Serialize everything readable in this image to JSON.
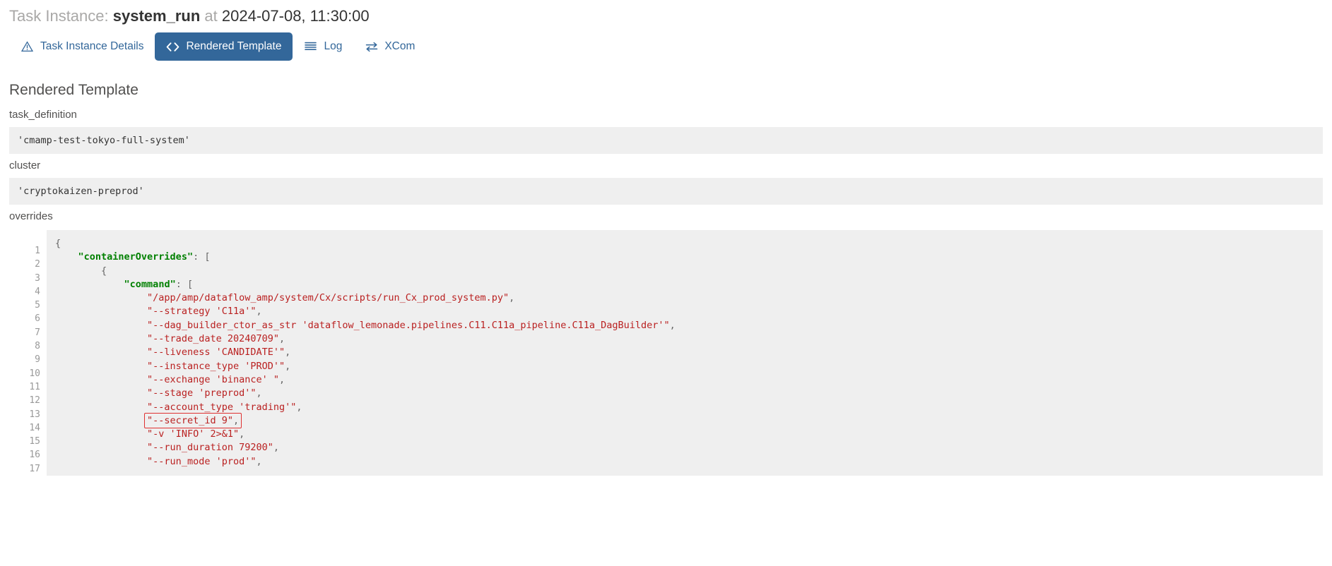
{
  "header": {
    "prefix": "Task Instance:",
    "task_id": "system_run",
    "at": "at",
    "timestamp": "2024-07-08, 11:30:00"
  },
  "tabs": [
    {
      "label": "Task Instance Details",
      "icon": "warning-triangle-icon",
      "active": false
    },
    {
      "label": "Rendered Template",
      "icon": "code-brackets-icon",
      "active": true
    },
    {
      "label": "Log",
      "icon": "list-lines-icon",
      "active": false
    },
    {
      "label": "XCom",
      "icon": "exchange-arrows-icon",
      "active": false
    }
  ],
  "section": {
    "title": "Rendered Template"
  },
  "fields": [
    {
      "label": "task_definition",
      "value": "'cmamp-test-tokyo-full-system'"
    },
    {
      "label": "cluster",
      "value": "'cryptokaizen-preprod'"
    },
    {
      "label": "overrides",
      "value": ""
    }
  ],
  "code_block": {
    "label": "overrides",
    "line_numbers": [
      1,
      2,
      3,
      4,
      5,
      6,
      7,
      8,
      9,
      10,
      11,
      12,
      13,
      14,
      15,
      16,
      17
    ],
    "lines": [
      {
        "indent": 0,
        "parts": [
          {
            "t": "punc",
            "v": "{"
          }
        ]
      },
      {
        "indent": 4,
        "parts": [
          {
            "t": "key",
            "v": "\"containerOverrides\""
          },
          {
            "t": "punc",
            "v": ": ["
          }
        ]
      },
      {
        "indent": 8,
        "parts": [
          {
            "t": "punc",
            "v": "{"
          }
        ]
      },
      {
        "indent": 12,
        "parts": [
          {
            "t": "key",
            "v": "\"command\""
          },
          {
            "t": "punc",
            "v": ": ["
          }
        ]
      },
      {
        "indent": 16,
        "parts": [
          {
            "t": "str",
            "v": "\"/app/amp/dataflow_amp/system/Cx/scripts/run_Cx_prod_system.py\""
          },
          {
            "t": "punc",
            "v": ","
          }
        ]
      },
      {
        "indent": 16,
        "parts": [
          {
            "t": "str",
            "v": "\"--strategy 'C11a'\""
          },
          {
            "t": "punc",
            "v": ","
          }
        ]
      },
      {
        "indent": 16,
        "parts": [
          {
            "t": "str",
            "v": "\"--dag_builder_ctor_as_str 'dataflow_lemonade.pipelines.C11.C11a_pipeline.C11a_DagBuilder'\""
          },
          {
            "t": "punc",
            "v": ","
          }
        ]
      },
      {
        "indent": 16,
        "parts": [
          {
            "t": "str",
            "v": "\"--trade_date 20240709\""
          },
          {
            "t": "punc",
            "v": ","
          }
        ]
      },
      {
        "indent": 16,
        "parts": [
          {
            "t": "str",
            "v": "\"--liveness 'CANDIDATE'\""
          },
          {
            "t": "punc",
            "v": ","
          }
        ]
      },
      {
        "indent": 16,
        "parts": [
          {
            "t": "str",
            "v": "\"--instance_type 'PROD'\""
          },
          {
            "t": "punc",
            "v": ","
          }
        ]
      },
      {
        "indent": 16,
        "parts": [
          {
            "t": "str",
            "v": "\"--exchange 'binance' \""
          },
          {
            "t": "punc",
            "v": ","
          }
        ]
      },
      {
        "indent": 16,
        "parts": [
          {
            "t": "str",
            "v": "\"--stage 'preprod'\""
          },
          {
            "t": "punc",
            "v": ","
          }
        ]
      },
      {
        "indent": 16,
        "parts": [
          {
            "t": "str",
            "v": "\"--account_type 'trading'\""
          },
          {
            "t": "punc",
            "v": ","
          }
        ]
      },
      {
        "indent": 16,
        "parts": [
          {
            "t": "str",
            "v": "\"--secret_id 9\""
          },
          {
            "t": "punc",
            "v": ","
          }
        ],
        "highlight": true
      },
      {
        "indent": 16,
        "parts": [
          {
            "t": "str",
            "v": "\"-v 'INFO' 2>&1\""
          },
          {
            "t": "punc",
            "v": ","
          }
        ]
      },
      {
        "indent": 16,
        "parts": [
          {
            "t": "str",
            "v": "\"--run_duration 79200\""
          },
          {
            "t": "punc",
            "v": ","
          }
        ]
      },
      {
        "indent": 16,
        "parts": [
          {
            "t": "str",
            "v": "\"--run_mode 'prod'\""
          },
          {
            "t": "punc",
            "v": ","
          }
        ]
      }
    ]
  },
  "colors": {
    "accent": "#33679a",
    "code_bg": "#efefef",
    "string": "#ba2121",
    "key": "#008000",
    "highlight_border": "#e03131",
    "muted_text": "#a9a8a7"
  }
}
